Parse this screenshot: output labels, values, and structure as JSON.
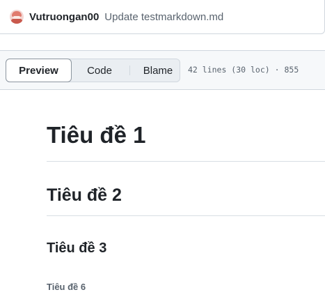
{
  "commit": {
    "author": "Vutruongan00",
    "message": "Update testmarkdown.md"
  },
  "file_header": {
    "tabs": [
      {
        "label": "Preview",
        "selected": true
      },
      {
        "label": "Code",
        "selected": false
      },
      {
        "label": "Blame",
        "selected": false
      }
    ],
    "file_info": "42 lines (30 loc) · 855"
  },
  "markdown": {
    "h1": "Tiêu đề 1",
    "h2": "Tiêu đề 2",
    "h3": "Tiêu đề 3",
    "h6": "Tiêu đề 6"
  },
  "colors": {
    "text": "#1f2328",
    "muted": "#59636e",
    "border": "#d0d7de",
    "header_bg": "#f6f8fa"
  }
}
